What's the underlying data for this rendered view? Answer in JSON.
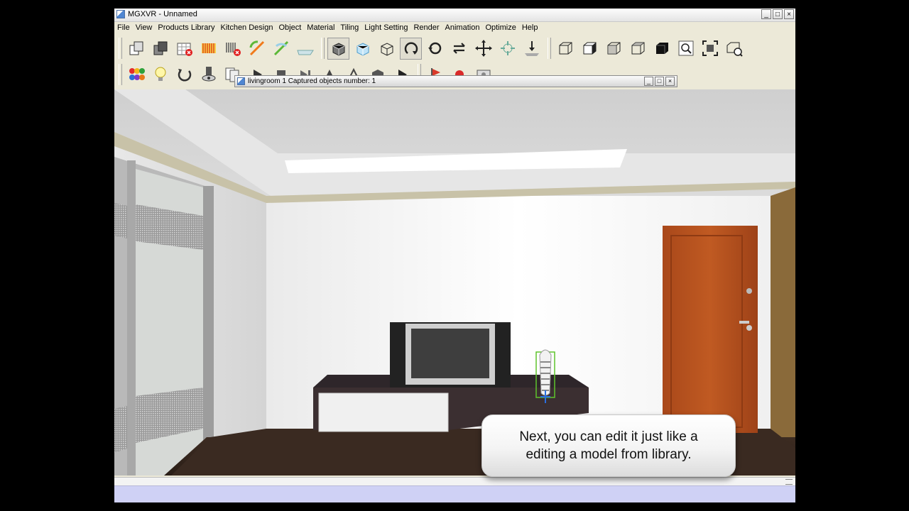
{
  "window": {
    "title": "MGXVR - Unnamed",
    "controls": {
      "minimize": "_",
      "maximize": "□",
      "close": "×"
    }
  },
  "menu": {
    "items": [
      "File",
      "View",
      "Products Library",
      "Kitchen Design",
      "Object",
      "Material",
      "Tiling",
      "Light Setting",
      "Render",
      "Animation",
      "Optimize",
      "Help"
    ]
  },
  "toolbar1": {
    "icons": [
      "copy-icon",
      "paste-icon",
      "delete-grid-icon",
      "striped-icon",
      "delete-striped-icon",
      "rotate-green-icon",
      "rotate-gradient-icon",
      "flat-plane-icon",
      "view-perspective-icon",
      "view-box-icon",
      "view-wireframe-icon",
      "rotate-cw-icon",
      "rotate-ccw-icon",
      "flip-icon",
      "move-icon",
      "center-icon",
      "drop-icon",
      "view-wire-cube-icon",
      "view-solid-cube-icon",
      "view-front-icon",
      "view-side-icon",
      "view-top-icon",
      "zoom-icon",
      "zoom-fit-icon",
      "zoom-selected-icon"
    ]
  },
  "toolbar2": {
    "icons": [
      "color-balls-icon",
      "light-bulb-icon",
      "refresh-icon",
      "camera-icon",
      "layers-icon"
    ]
  },
  "inner_window": {
    "title": "livingroom 1 Captured objects number: 1"
  },
  "colors": {
    "window_bg": "#ece9d8",
    "status_bar": "#cfd1f5",
    "door": "#b5521d",
    "floor": "#3a2a22",
    "selection": "#5ec42c"
  },
  "caption": {
    "line1": "Next, you can edit it just like a",
    "line2": "editing a model from library."
  }
}
